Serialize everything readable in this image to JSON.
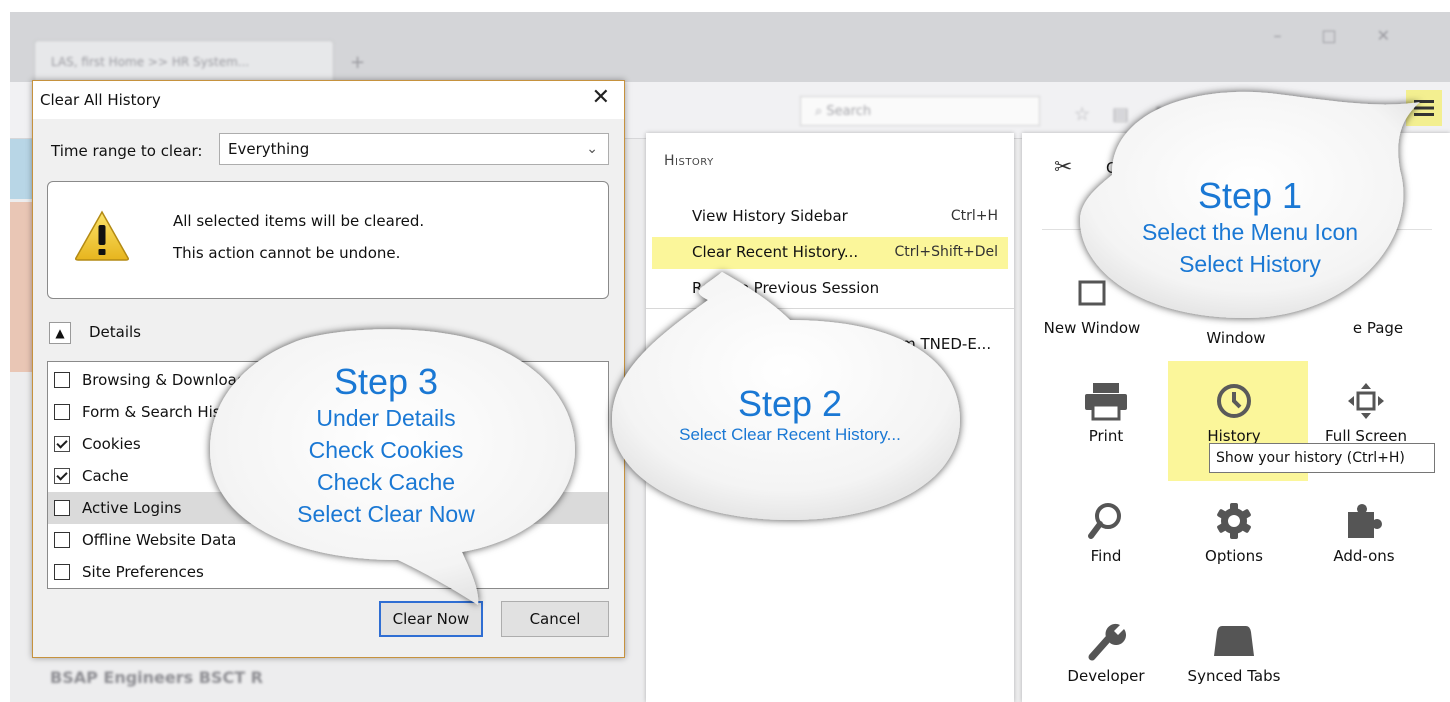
{
  "dialog": {
    "title": "Clear All History",
    "time_range_label": "Time range to clear:",
    "time_range_value": "Everything",
    "warning_line1": "All selected items will be cleared.",
    "warning_line2": "This action cannot be undone.",
    "details_label": "Details",
    "items": [
      {
        "label": "Browsing & Download History",
        "checked": false
      },
      {
        "label": "Form & Search History",
        "checked": false
      },
      {
        "label": "Cookies",
        "checked": true
      },
      {
        "label": "Cache",
        "checked": true
      },
      {
        "label": "Active Logins",
        "checked": false,
        "highlighted": true
      },
      {
        "label": "Offline Website Data",
        "checked": false
      },
      {
        "label": "Site Preferences",
        "checked": false
      }
    ],
    "clear_button": "Clear Now",
    "cancel_button": "Cancel"
  },
  "history_panel": {
    "heading": "History",
    "items": [
      {
        "label": "View History Sidebar",
        "shortcut": "Ctrl+H"
      },
      {
        "label": "Clear Recent History...",
        "shortcut": "Ctrl+Shift+Del",
        "highlighted": true
      },
      {
        "label": "Restore Previous Session",
        "shortcut": ""
      }
    ],
    "recent_entry": "tem TNED-E..."
  },
  "menu_panel": {
    "cut_label": "Cut",
    "tiles": {
      "new_window": "New Window",
      "private_window": "Window",
      "save_page": "e Page",
      "print": "Print",
      "history": "History",
      "full_screen": "Full Screen",
      "find": "Find",
      "options": "Options",
      "addons": "Add-ons",
      "developer": "Developer",
      "synced_tabs": "Synced Tabs"
    },
    "tooltip": "Show your history (Ctrl+H)"
  },
  "browser_bg": {
    "tab_title": "LAS, first Home >> HR System...",
    "search_placeholder": "Search",
    "blur_text": "BSAP Engineers  BSCT R"
  },
  "callouts": {
    "step1": {
      "title": "Step 1",
      "lines": [
        "Select the Menu Icon",
        "Select History"
      ]
    },
    "step2": {
      "title": "Step 2",
      "lines": [
        "Select Clear Recent History..."
      ]
    },
    "step3": {
      "title": "Step 3",
      "lines": [
        "Under Details",
        "Check Cookies",
        "Check Cache",
        "Select Clear Now"
      ]
    }
  },
  "colors": {
    "highlight": "#fbf69a",
    "callout_text": "#1a78d4",
    "dialog_border": "#c6923e",
    "primary_button_border": "#2f6ed3"
  },
  "icons": {
    "warning": "warning-triangle-icon",
    "menu": "hamburger-menu-icon",
    "cut": "scissors-icon",
    "print": "printer-icon",
    "history": "clock-icon",
    "full_screen": "fullscreen-arrows-icon",
    "find": "magnifier-icon",
    "options": "gear-icon",
    "addons": "puzzle-piece-icon",
    "developer": "wrench-icon",
    "synced_tabs": "synced-tabs-icon"
  }
}
